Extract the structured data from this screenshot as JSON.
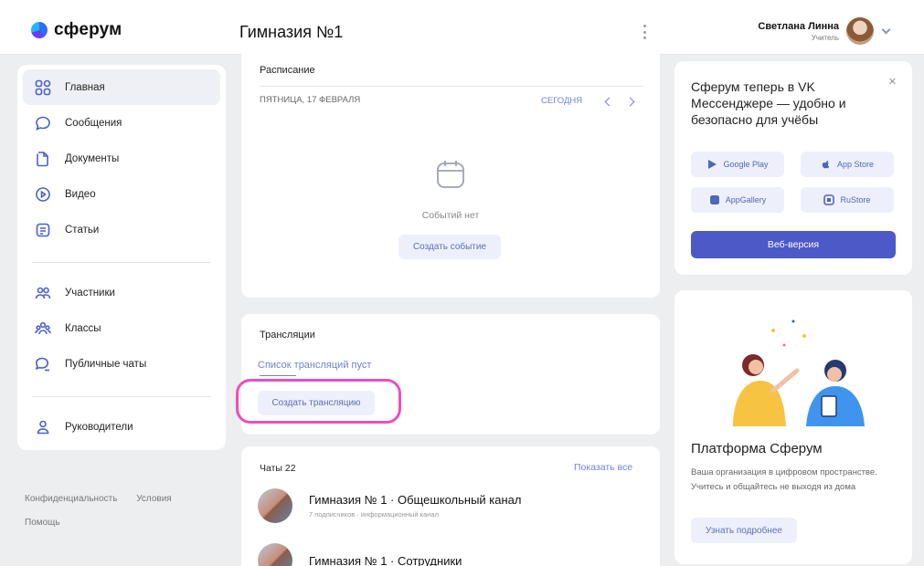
{
  "header": {
    "logo_text": "сферум",
    "org_title": "Гимназия №1",
    "user_name": "Светлана Линна",
    "user_role": "Учитель"
  },
  "sidebar": {
    "items": [
      {
        "label": "Главная",
        "icon": "home-icon"
      },
      {
        "label": "Сообщения",
        "icon": "chat-bubble-icon"
      },
      {
        "label": "Документы",
        "icon": "document-icon"
      },
      {
        "label": "Видео",
        "icon": "play-icon"
      },
      {
        "label": "Статьи",
        "icon": "article-icon"
      }
    ],
    "group2": [
      {
        "label": "Участники",
        "icon": "users-icon"
      },
      {
        "label": "Классы",
        "icon": "groups-icon"
      },
      {
        "label": "Публичные чаты",
        "icon": "public-chat-icon"
      }
    ],
    "group3": [
      {
        "label": "Руководители",
        "icon": "person-icon"
      }
    ]
  },
  "footer": {
    "privacy": "Конфиденциальность",
    "terms": "Условия",
    "help": "Помощь"
  },
  "schedule": {
    "title": "Расписание",
    "date": "ПЯТНИЦА, 17 ФЕВРАЛЯ",
    "today": "СЕГОДНЯ",
    "empty": "Событий нет",
    "create": "Создать событие"
  },
  "streams": {
    "title": "Трансляции",
    "empty": "Список трансляций пуст",
    "create": "Создать трансляцию"
  },
  "chats": {
    "title": "Чаты 22",
    "show_all": "Показать все",
    "items": [
      {
        "name": "Гимназия № 1 · Общешкольный канал",
        "meta": "7 подписчиков · информационный канал"
      },
      {
        "name": "Гимназия № 1 · Сотрудники",
        "meta": ""
      }
    ]
  },
  "promo": {
    "text": "Сферум теперь в VK Мессенджере — удобно и безопасно для учёбы",
    "google_play": "Google Play",
    "app_store": "App Store",
    "app_gallery": "AppGallery",
    "rustore": "RuStore",
    "web": "Веб-версия"
  },
  "platform": {
    "title": "Платформа Сферум",
    "desc": "Ваша организация в цифровом пространстве. Учитесь и общайтесь не выходя из дома",
    "more": "Узнать подробнее"
  },
  "colors": {
    "accent": "#4c59c7",
    "link": "#6f84d6",
    "highlight": "#ea4fbf"
  }
}
